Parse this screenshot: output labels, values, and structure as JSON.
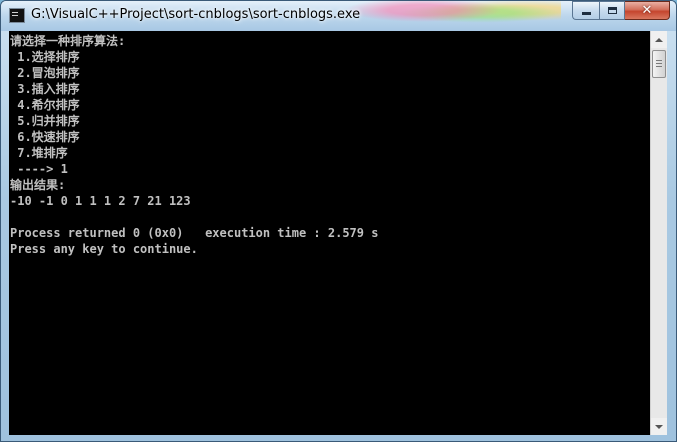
{
  "window": {
    "title": "G:\\VisualC++Project\\sort-cnblogs\\sort-cnblogs.exe"
  },
  "caption": {
    "minimize_icon": "minimize-icon",
    "maximize_icon": "maximize-icon",
    "close_icon": "close-icon",
    "close_glyph": "✕"
  },
  "console": {
    "lines": [
      "请选择一种排序算法:",
      " 1.选择排序",
      " 2.冒泡排序",
      " 3.插入排序",
      " 4.希尔排序",
      " 5.归并排序",
      " 6.快速排序",
      " 7.堆排序",
      " ----> 1",
      "输出结果:",
      "-10 -1 0 1 1 1 2 7 21 123",
      "",
      "Process returned 0 (0x0)   execution time : 2.579 s",
      "Press any key to continue."
    ],
    "colors": {
      "background": "#000000",
      "text": "#c0c0c0"
    }
  }
}
